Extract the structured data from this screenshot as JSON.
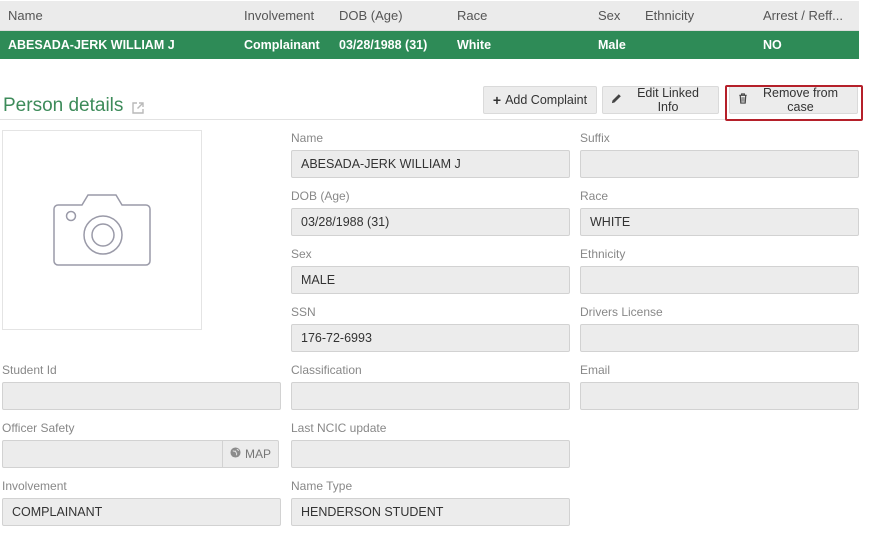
{
  "table": {
    "headers": [
      "Name",
      "Involvement",
      "DOB (Age)",
      "Race",
      "Sex",
      "Ethnicity",
      "Arrest / Reff..."
    ],
    "row": [
      "ABESADA-JERK WILLIAM J",
      "Complainant",
      "03/28/1988 (31)",
      "White",
      "Male",
      "",
      "NO"
    ]
  },
  "section": {
    "title": "Person details"
  },
  "buttons": {
    "add_complaint": "Add Complaint",
    "edit_linked": "Edit Linked Info",
    "remove_case": "Remove from case"
  },
  "fields": {
    "name": {
      "label": "Name",
      "value": "ABESADA-JERK WILLIAM J"
    },
    "suffix": {
      "label": "Suffix",
      "value": ""
    },
    "dob": {
      "label": "DOB (Age)",
      "value": "03/28/1988 (31)"
    },
    "race": {
      "label": "Race",
      "value": "WHITE"
    },
    "sex": {
      "label": "Sex",
      "value": "MALE"
    },
    "ethnicity": {
      "label": "Ethnicity",
      "value": ""
    },
    "ssn": {
      "label": "SSN",
      "value": "176-72-6993"
    },
    "drivers_license": {
      "label": "Drivers License",
      "value": ""
    },
    "student_id": {
      "label": "Student Id",
      "value": ""
    },
    "classification": {
      "label": "Classification",
      "value": ""
    },
    "email": {
      "label": "Email",
      "value": ""
    },
    "officer_safety": {
      "label": "Officer Safety",
      "value": "",
      "addon": "MAP"
    },
    "last_ncic": {
      "label": "Last NCIC update",
      "value": ""
    },
    "involvement": {
      "label": "Involvement",
      "value": "COMPLAINANT"
    },
    "name_type": {
      "label": "Name Type",
      "value": "HENDERSON STUDENT"
    }
  },
  "colors": {
    "accent": "#2e8b57",
    "highlight": "#b5202a"
  }
}
